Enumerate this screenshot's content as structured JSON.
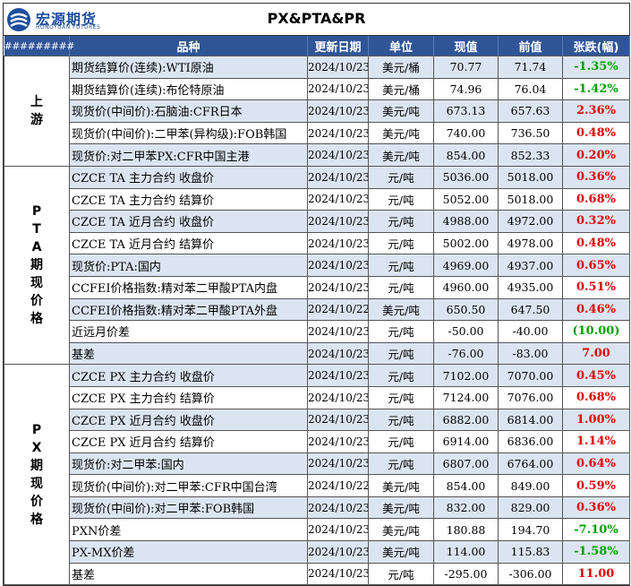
{
  "header": {
    "logo_cn": "宏源期货",
    "logo_en": "HONGYUAN FUTURES",
    "title": "PX&PTA&PR"
  },
  "columns": [
    "#########",
    "品种",
    "更新日期",
    "单位",
    "现值",
    "前值",
    "张跌(幅)"
  ],
  "colors": {
    "header_bg": "#2f5597",
    "up": "#e00000",
    "down": "#00a000",
    "stripe": "#dbe5f1",
    "logo": "#1d4e9e"
  },
  "sections": [
    {
      "label_chars": [
        "上",
        "游"
      ],
      "rows": [
        {
          "name": "期货结算价(连续):WTI原油",
          "date": "2024/10/23",
          "unit": "美元/桶",
          "cur": "70.77",
          "prev": "71.74",
          "chg": "-1.35%",
          "dir": "neg"
        },
        {
          "name": "期货结算价(连续):布伦特原油",
          "date": "2024/10/23",
          "unit": "美元/桶",
          "cur": "74.96",
          "prev": "76.04",
          "chg": "-1.42%",
          "dir": "neg"
        },
        {
          "name": "现货价(中间价):石脑油:CFR日本",
          "date": "2024/10/23",
          "unit": "美元/吨",
          "cur": "673.13",
          "prev": "657.63",
          "chg": "2.36%",
          "dir": "pos"
        },
        {
          "name": "现货价(中间价):二甲苯(异构级):FOB韩国",
          "date": "2024/10/23",
          "unit": "美元/吨",
          "cur": "740.00",
          "prev": "736.50",
          "chg": "0.48%",
          "dir": "pos"
        },
        {
          "name": "现货价:对二甲苯PX:CFR中国主港",
          "date": "2024/10/23",
          "unit": "美元/吨",
          "cur": "854.00",
          "prev": "852.33",
          "chg": "0.20%",
          "dir": "pos"
        }
      ]
    },
    {
      "label_chars": [
        "P",
        "T",
        "A",
        "期",
        "现",
        "价",
        "格"
      ],
      "rows": [
        {
          "name": "CZCE TA 主力合约 收盘价",
          "date": "2024/10/23",
          "unit": "元/吨",
          "cur": "5036.00",
          "prev": "5018.00",
          "chg": "0.36%",
          "dir": "pos"
        },
        {
          "name": "CZCE TA 主力合约 结算价",
          "date": "2024/10/23",
          "unit": "元/吨",
          "cur": "5052.00",
          "prev": "5018.00",
          "chg": "0.68%",
          "dir": "pos"
        },
        {
          "name": "CZCE TA 近月合约 收盘价",
          "date": "2024/10/23",
          "unit": "元/吨",
          "cur": "4988.00",
          "prev": "4972.00",
          "chg": "0.32%",
          "dir": "pos"
        },
        {
          "name": "CZCE TA 近月合约 结算价",
          "date": "2024/10/23",
          "unit": "元/吨",
          "cur": "5002.00",
          "prev": "4978.00",
          "chg": "0.48%",
          "dir": "pos"
        },
        {
          "name": "现货价:PTA:国内",
          "date": "2024/10/23",
          "unit": "元/吨",
          "cur": "4969.00",
          "prev": "4937.00",
          "chg": "0.65%",
          "dir": "pos"
        },
        {
          "name": "CCFEI价格指数:精对苯二甲酸PTA内盘",
          "date": "2024/10/23",
          "unit": "元/吨",
          "cur": "4960.00",
          "prev": "4935.00",
          "chg": "0.51%",
          "dir": "pos"
        },
        {
          "name": "CCFEI价格指数:精对苯二甲酸PTA外盘",
          "date": "2024/10/22",
          "unit": "美元/吨",
          "cur": "650.50",
          "prev": "647.50",
          "chg": "0.46%",
          "dir": "pos"
        },
        {
          "name": "近远月价差",
          "date": "2024/10/23",
          "unit": "元/吨",
          "cur": "-50.00",
          "prev": "-40.00",
          "chg": "(10.00)",
          "dir": "neg"
        },
        {
          "name": "基差",
          "date": "2024/10/23",
          "unit": "元/吨",
          "cur": "-76.00",
          "prev": "-83.00",
          "chg": "7.00",
          "dir": "pos"
        }
      ]
    },
    {
      "label_chars": [
        "P",
        "X",
        "期",
        "现",
        "价",
        "格"
      ],
      "rows": [
        {
          "name": "CZCE PX 主力合约 收盘价",
          "date": "2024/10/23",
          "unit": "元/吨",
          "cur": "7102.00",
          "prev": "7070.00",
          "chg": "0.45%",
          "dir": "pos"
        },
        {
          "name": "CZCE PX 主力合约 结算价",
          "date": "2024/10/23",
          "unit": "元/吨",
          "cur": "7124.00",
          "prev": "7076.00",
          "chg": "0.68%",
          "dir": "pos"
        },
        {
          "name": "CZCE PX 近月合约 收盘价",
          "date": "2024/10/23",
          "unit": "元/吨",
          "cur": "6882.00",
          "prev": "6814.00",
          "chg": "1.00%",
          "dir": "pos"
        },
        {
          "name": "CZCE PX 近月合约 结算价",
          "date": "2024/10/23",
          "unit": "元/吨",
          "cur": "6914.00",
          "prev": "6836.00",
          "chg": "1.14%",
          "dir": "pos"
        },
        {
          "name": "现货价:对二甲苯:国内",
          "date": "2024/10/23",
          "unit": "元/吨",
          "cur": "6807.00",
          "prev": "6764.00",
          "chg": "0.64%",
          "dir": "pos"
        },
        {
          "name": "现货价(中间价):对二甲苯:CFR中国台湾",
          "date": "2024/10/22",
          "unit": "美元/吨",
          "cur": "854.00",
          "prev": "849.00",
          "chg": "0.59%",
          "dir": "pos"
        },
        {
          "name": "现货价(中间价):对二甲苯:FOB韩国",
          "date": "2024/10/23",
          "unit": "美元/吨",
          "cur": "832.00",
          "prev": "829.00",
          "chg": "0.36%",
          "dir": "pos"
        },
        {
          "name": "PXN价差",
          "date": "2024/10/23",
          "unit": "美元/吨",
          "cur": "180.88",
          "prev": "194.70",
          "chg": "-7.10%",
          "dir": "neg"
        },
        {
          "name": "PX-MX价差",
          "date": "2024/10/23",
          "unit": "美元/吨",
          "cur": "114.00",
          "prev": "115.83",
          "chg": "-1.58%",
          "dir": "neg"
        },
        {
          "name": "基差",
          "date": "2024/10/23",
          "unit": "元/吨",
          "cur": "-295.00",
          "prev": "-306.00",
          "chg": "11.00",
          "dir": "pos"
        }
      ]
    }
  ]
}
